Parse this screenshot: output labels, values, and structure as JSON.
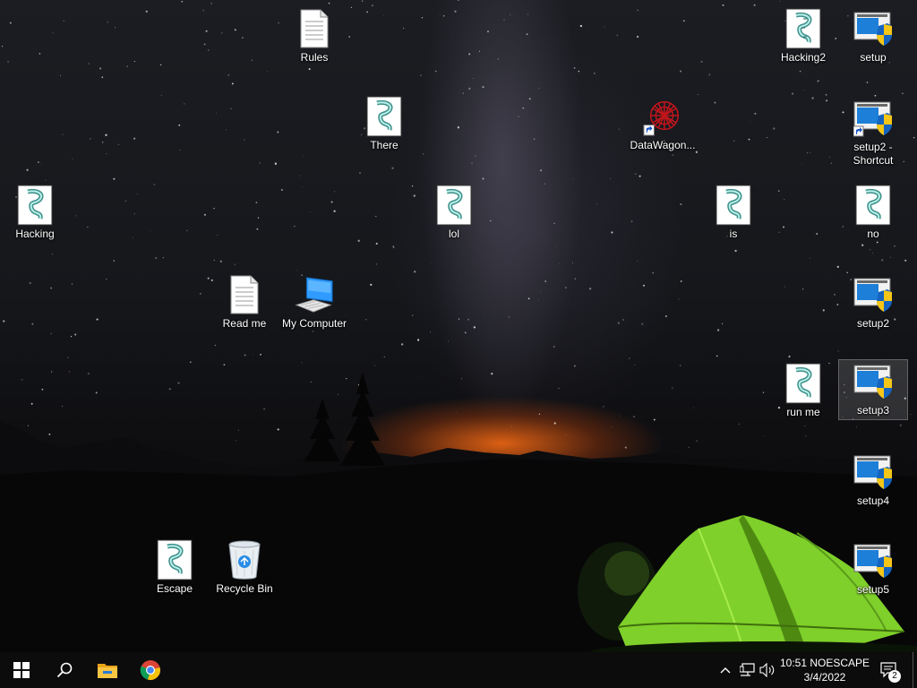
{
  "desktop": {
    "icons": {
      "rules": {
        "label": "Rules",
        "icon": "text-document-icon"
      },
      "hacking2": {
        "label": "Hacking2",
        "icon": "script-icon"
      },
      "setup": {
        "label": "setup",
        "icon": "installer-shield-icon"
      },
      "there": {
        "label": "There",
        "icon": "script-icon"
      },
      "datawagon": {
        "label": "DataWagon...",
        "icon": "red-web-shortcut-icon"
      },
      "setup2_shortcut": {
        "label": "setup2 -\nShortcut",
        "icon": "installer-shield-icon"
      },
      "hacking": {
        "label": "Hacking",
        "icon": "script-icon"
      },
      "lol": {
        "label": "lol",
        "icon": "script-icon"
      },
      "is": {
        "label": "is",
        "icon": "script-icon"
      },
      "no": {
        "label": "no",
        "icon": "script-icon"
      },
      "read_me": {
        "label": "Read me",
        "icon": "text-document-icon"
      },
      "my_computer": {
        "label": "My Computer",
        "icon": "computer-icon"
      },
      "setup2": {
        "label": "setup2",
        "icon": "installer-shield-icon"
      },
      "run_me": {
        "label": "run me",
        "icon": "script-icon"
      },
      "setup3": {
        "label": "setup3",
        "icon": "installer-shield-icon"
      },
      "setup4": {
        "label": "setup4",
        "icon": "installer-shield-icon"
      },
      "escape": {
        "label": "Escape",
        "icon": "script-icon"
      },
      "recycle_bin": {
        "label": "Recycle Bin",
        "icon": "recycle-bin-icon"
      },
      "setup5": {
        "label": "setup5",
        "icon": "installer-shield-icon"
      }
    },
    "selected_icon": "setup3"
  },
  "taskbar": {
    "pinned": [
      "windows-start-icon",
      "search-icon",
      "file-explorer-icon",
      "chrome-icon"
    ],
    "tray_icons": [
      "chevron-up-icon",
      "network-icon",
      "volume-icon"
    ],
    "clock": {
      "time": "10:51 NOESCAPE",
      "date": "3/4/2022"
    },
    "notification_count": "2"
  },
  "colors": {
    "taskbar_bg": "#0c0c0d",
    "tent_green": "#7fd02a",
    "horizon_orange": "#ff6e14"
  }
}
